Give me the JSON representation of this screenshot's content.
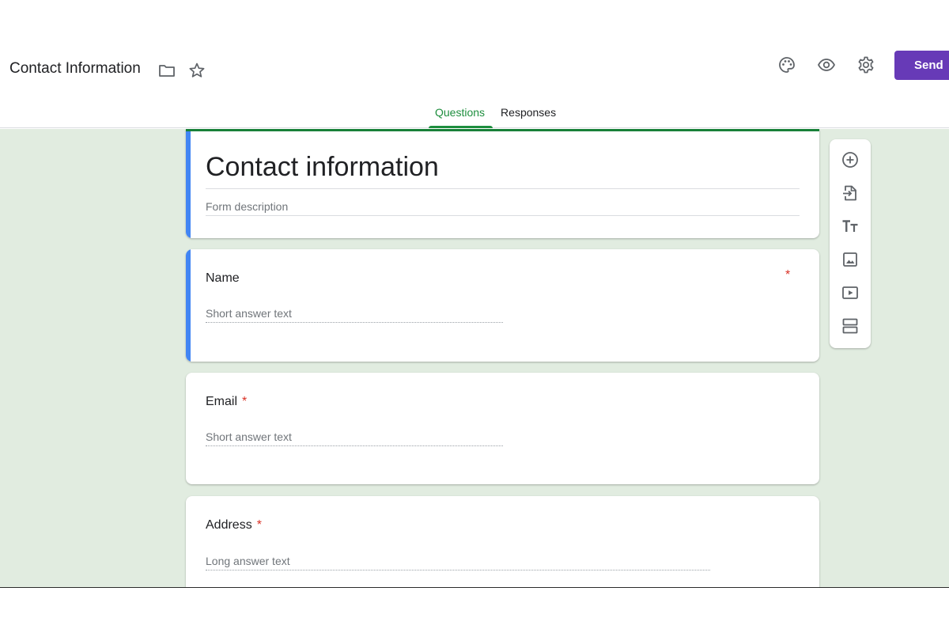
{
  "header": {
    "doc_title": "Contact Information",
    "icons": [
      "folder-icon",
      "star-icon",
      "palette-icon",
      "eye-icon",
      "gear-icon"
    ],
    "send_label": "Send"
  },
  "tabs": [
    {
      "label": "Questions",
      "active": true
    },
    {
      "label": "Responses",
      "active": false
    }
  ],
  "form": {
    "title": "Contact information",
    "description_placeholder": "Form description"
  },
  "questions": [
    {
      "title": "Name",
      "required": true,
      "answer_placeholder": "Short answer text"
    },
    {
      "title": "Email",
      "required": true,
      "answer_placeholder": "Short answer text"
    },
    {
      "title": "Address",
      "required": true,
      "answer_placeholder": "Long answer text"
    }
  ],
  "required_marker": "*",
  "toolbar": {
    "icons": [
      "add-question-icon",
      "import-questions-icon",
      "add-title-icon",
      "add-image-icon",
      "add-video-icon",
      "add-section-icon"
    ]
  },
  "colors": {
    "accent": "#673ab7",
    "tab_active": "#1e8e3e",
    "background": "#e1ece0",
    "focus_bar": "#4285f4",
    "required": "#d93025"
  }
}
